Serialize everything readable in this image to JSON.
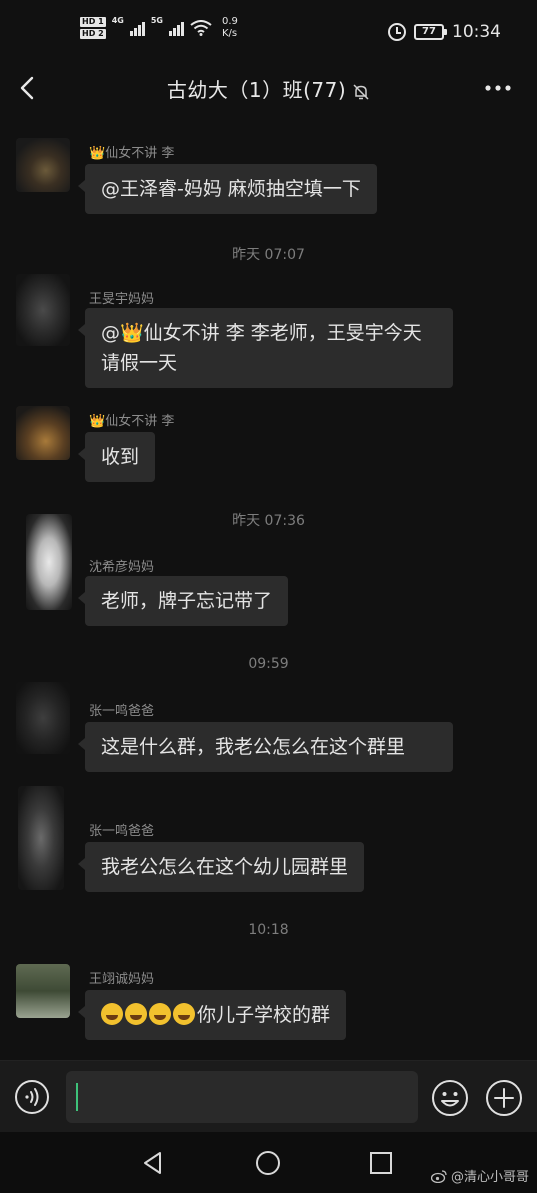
{
  "status_bar": {
    "hd1": "HD 1",
    "hd2": "HD 2",
    "net1": "4G",
    "net2": "5G",
    "speed_value": "0.9",
    "speed_unit": "K/s",
    "battery": "77",
    "time": "10:34"
  },
  "header": {
    "title": "古幼大（1）班(77)"
  },
  "messages": [
    {
      "sender_crown": "👑",
      "sender": "仙女不讲  李",
      "text": "@王泽睿-妈妈  麻烦抽空填一下"
    },
    {
      "timestamp": "昨天 07:07"
    },
    {
      "sender": "王旻宇妈妈",
      "text_prefix": "@",
      "text_crown": "👑",
      "text": "仙女不讲  李    李老师，王旻宇今天请假一天"
    },
    {
      "sender_crown": "👑",
      "sender": "仙女不讲  李",
      "text": "收到"
    },
    {
      "timestamp": "昨天 07:36"
    },
    {
      "sender": "沈希彦妈妈",
      "text": "老师，牌子忘记带了"
    },
    {
      "timestamp": "09:59"
    },
    {
      "sender": "张一鸣爸爸",
      "text": "这是什么群，我老公怎么在这个群里"
    },
    {
      "sender": "张一鸣爸爸",
      "text": "我老公怎么在这个幼儿园群里"
    },
    {
      "timestamp": "10:18"
    },
    {
      "sender": "王翊诚妈妈",
      "text": "你儿子学校的群"
    }
  ],
  "input": {
    "value": ""
  },
  "icons": {
    "back": "back-chevron-icon",
    "mute": "bell-muted-icon",
    "more": "more-dots-icon",
    "voice": "voice-icon",
    "emoji": "emoji-icon",
    "plus": "plus-icon"
  },
  "watermark": {
    "text": "@清心小哥哥"
  },
  "colors": {
    "background": "#111111",
    "bubble": "#2c2c2c",
    "crown": "#d9b23a",
    "caret": "#3ec27a"
  }
}
